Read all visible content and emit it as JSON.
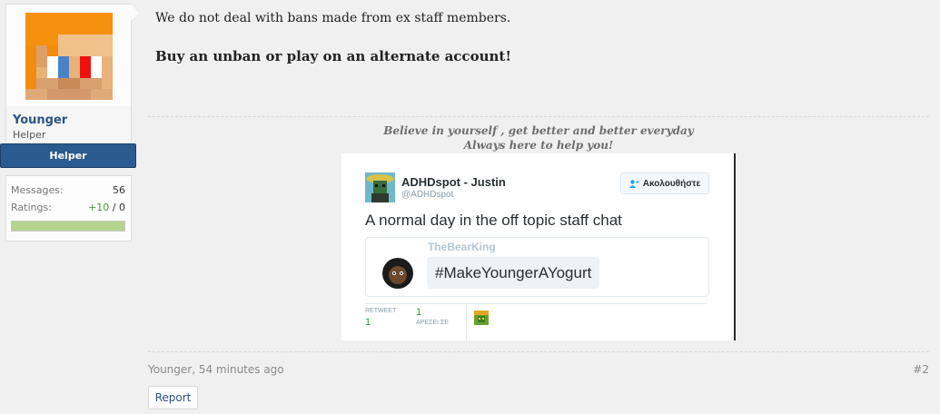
{
  "user": {
    "avatar_icon": "minecraft-skin-face-icon",
    "username": "Younger",
    "title": "Helper",
    "rank_banner": "Helper",
    "rank_color": "#2b5a8e"
  },
  "stats": {
    "messages_label": "Messages:",
    "messages_value": "56",
    "ratings_label": "Ratings:",
    "ratings_positive": "+10",
    "ratings_sep": " / ",
    "ratings_negative": "0",
    "rating_fill_fraction": 1.0
  },
  "message": {
    "line1": "We do not deal with bans made from ex staff members.",
    "line2": "Buy an unban or play on an alternate account!"
  },
  "signature": {
    "line1": "Believe in yourself , get better and better everyday",
    "line2": "Always here to help you!"
  },
  "tweet": {
    "author_name": "ADHDspot - Justin",
    "author_handle": "@ADHDspot",
    "follow_label": "Ακολουθήστε",
    "text": "A normal day in the off topic staff chat",
    "quote_name": "TheBearKing",
    "quote_text": "#MakeYoungerAYogurt",
    "retweet_label": "RETWEET",
    "retweet_count": "1",
    "fav_label": "ΑΡΕΣΕΙ ΣΕ",
    "fav_count": "1"
  },
  "footer": {
    "meta": "Younger, 54 minutes ago",
    "post_number": "#2",
    "report_label": "Report"
  },
  "colors": {
    "page_bg": "#f0f0f0",
    "link": "#2b5485",
    "rating_positive": "#4a9a33",
    "rating_bar": "#b6d48e"
  }
}
